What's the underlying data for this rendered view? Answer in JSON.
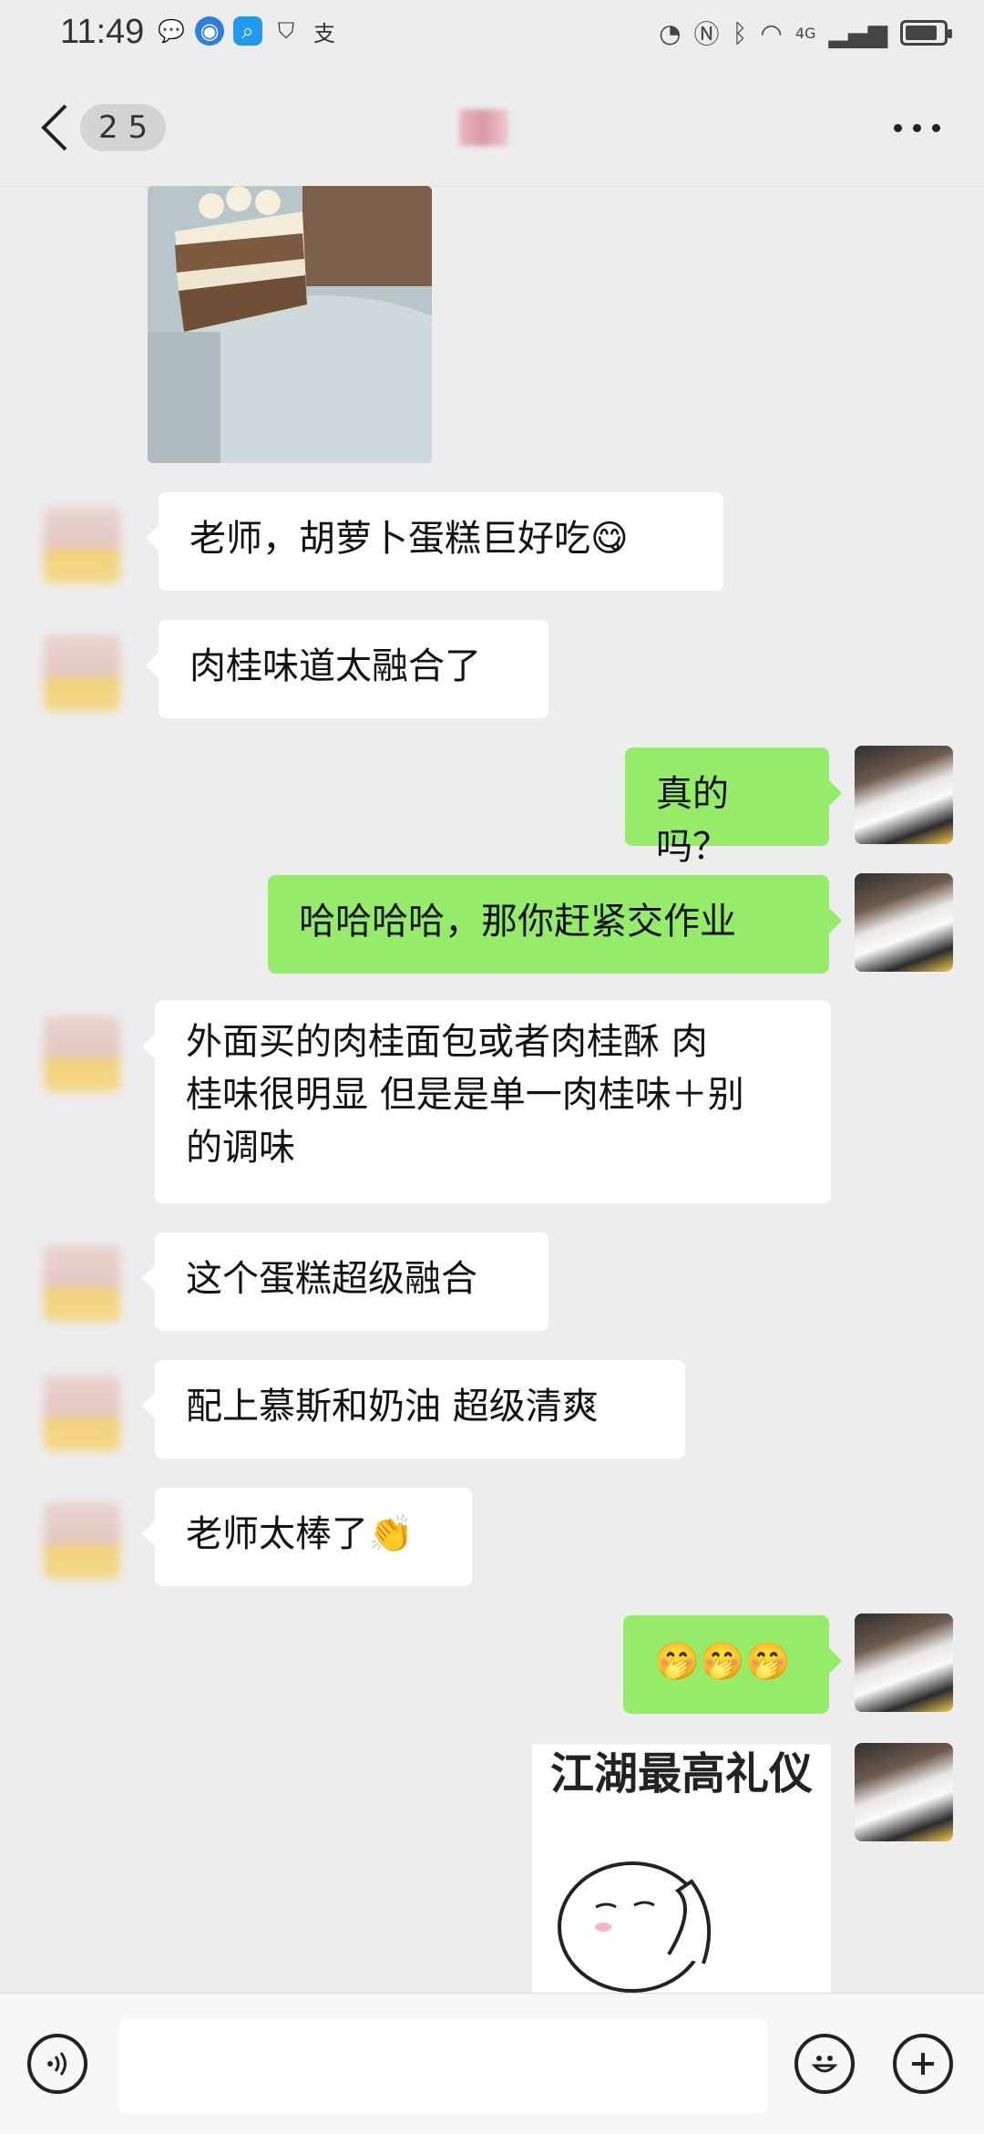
{
  "status": {
    "time": "11:49",
    "network": "4G",
    "battery_level": 0.85
  },
  "header": {
    "back_count": "2 5"
  },
  "messages": [
    {
      "from": "other",
      "text": "老师，胡萝卜蛋糕巨好吃😋"
    },
    {
      "from": "other",
      "text": "肉桂味道太融合了"
    },
    {
      "from": "me",
      "text": "真的吗？"
    },
    {
      "from": "me",
      "text": "哈哈哈哈，那你赶紧交作业"
    },
    {
      "from": "other",
      "lines": [
        "外面买的肉桂面包或者肉桂酥 肉",
        "桂味很明显 但是是单一肉桂味＋别",
        "的调味"
      ]
    },
    {
      "from": "other",
      "text": "这个蛋糕超级融合"
    },
    {
      "from": "other",
      "text": "配上慕斯和奶油 超级清爽"
    },
    {
      "from": "other",
      "text": "老师太棒了👏"
    },
    {
      "from": "me",
      "text": "🤭🤭🤭"
    }
  ],
  "sticker": {
    "title": "江湖最高礼仪"
  },
  "icons": {
    "back": "chevron-left-icon",
    "more": "more-dots-icon",
    "voice": "voice-icon",
    "emoji": "emoji-icon",
    "add": "plus-icon"
  }
}
